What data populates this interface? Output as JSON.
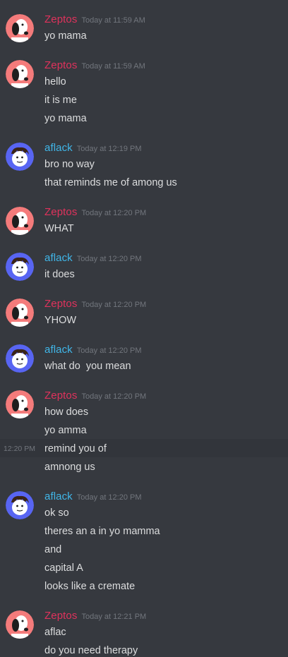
{
  "users": {
    "zeptos": {
      "name": "Zeptos",
      "color": "#e0325c"
    },
    "aflack": {
      "name": "aflack",
      "color": "#40b6e8"
    }
  },
  "messages": [
    {
      "author": "Zeptos",
      "time": "Today at 11:59 AM",
      "lines": [
        "yo mama"
      ]
    },
    {
      "author": "Zeptos",
      "time": "Today at 11:59 AM",
      "lines": [
        "hello",
        "it is me",
        "yo mama"
      ]
    },
    {
      "author": "aflack",
      "time": "Today at 12:19 PM",
      "lines": [
        "bro no way",
        "that reminds me of among us"
      ]
    },
    {
      "author": "Zeptos",
      "time": "Today at 12:20 PM",
      "lines": [
        "WHAT"
      ]
    },
    {
      "author": "aflack",
      "time": "Today at 12:20 PM",
      "lines": [
        "it does"
      ]
    },
    {
      "author": "Zeptos",
      "time": "Today at 12:20 PM",
      "lines": [
        "YHOW"
      ]
    },
    {
      "author": "aflack",
      "time": "Today at 12:20 PM",
      "lines": [
        "what do  you mean"
      ]
    },
    {
      "author": "Zeptos",
      "time": "Today at 12:20 PM",
      "lines": [
        "how does",
        "yo amma",
        "remind you of",
        "amnong us"
      ]
    },
    {
      "author": "aflack",
      "time": "Today at 12:20 PM",
      "lines": [
        "ok so",
        "theres an a in yo mamma",
        "and",
        "capital A",
        "looks like a cremate"
      ]
    },
    {
      "author": "Zeptos",
      "time": "Today at 12:21 PM",
      "lines": [
        "aflac",
        "do you need therapy"
      ]
    }
  ],
  "hovered_line": {
    "group": 7,
    "line": 2,
    "timestamp": "12:20 PM"
  },
  "avatars": {
    "zeptos": "snoopy-dog-avatar",
    "aflack": "cartoon-face-avatar"
  }
}
